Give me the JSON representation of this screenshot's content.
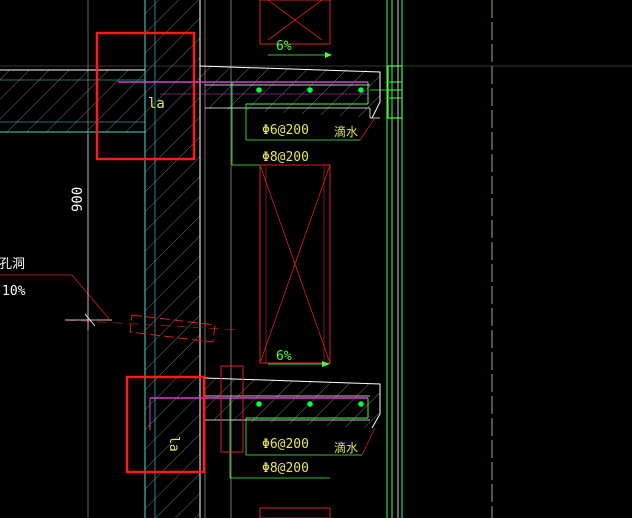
{
  "colors": {
    "background": "#000000",
    "wall_outline": "#ffffff",
    "hatch": "#8a8a8a",
    "cyan": "#4fd6d6",
    "green": "#44ff44",
    "yellow": "#e6e65a",
    "red": "#ff2020",
    "magenta": "#d040d0",
    "bright_green": "#00ff40"
  },
  "labels": {
    "slope_top": "6%",
    "slope_mid": "6%",
    "la_top": "la",
    "la_bottom": "la",
    "rebar_top_1": "Φ6@200",
    "rebar_top_2": "Φ8@200",
    "rebar_bottom_1": "Φ6@200",
    "rebar_bottom_2": "Φ8@200",
    "drip_top": "滴水",
    "drip_bottom": "滴水",
    "dimension_900": "900",
    "hole_note_1": "洞孔洞",
    "hole_note_2": "10%"
  }
}
